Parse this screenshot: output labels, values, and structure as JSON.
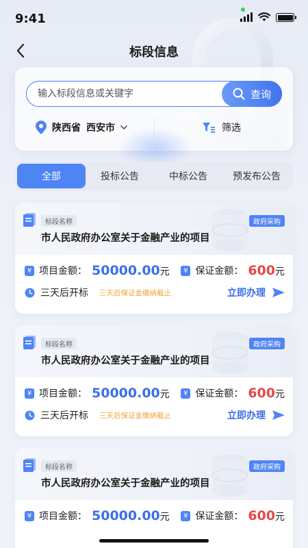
{
  "status_bar": {
    "time": "9:41"
  },
  "nav": {
    "title": "标段信息"
  },
  "search": {
    "placeholder": "输入标段信息或关键字",
    "button_label": "查询"
  },
  "location": {
    "province": "陕西省",
    "city": "西安市"
  },
  "filter": {
    "label": "筛选"
  },
  "tabs": [
    {
      "label": "全部",
      "active": true
    },
    {
      "label": "投标公告",
      "active": false
    },
    {
      "label": "中标公告",
      "active": false
    },
    {
      "label": "预发布公告",
      "active": false
    }
  ],
  "cards": [
    {
      "tag": "标段名称",
      "category": "政府采购",
      "title": "市人民政府办公室关于金融产业的项目",
      "amount_label": "项目金额：",
      "amount_value": "50000.00",
      "amount_unit": "元",
      "deposit_label": "保证金额：",
      "deposit_value": "600",
      "deposit_unit": "元",
      "open_text": "三天后开标",
      "deadline_note": "三天后保证金缴纳截止",
      "action": "立即办理"
    },
    {
      "tag": "标段名称",
      "category": "政府采购",
      "title": "市人民政府办公室关于金融产业的项目",
      "amount_label": "项目金额：",
      "amount_value": "50000.00",
      "amount_unit": "元",
      "deposit_label": "保证金额：",
      "deposit_value": "600",
      "deposit_unit": "元",
      "open_text": "三天后开标",
      "deadline_note": "三天后保证金缴纳截止",
      "action": "立即办理"
    },
    {
      "tag": "标段名称",
      "category": "政府采购",
      "title": "市人民政府办公室关于金融产业的项目",
      "amount_label": "项目金额：",
      "amount_value": "50000.00",
      "amount_unit": "元",
      "deposit_label": "保证金额：",
      "deposit_value": "600",
      "deposit_unit": "元"
    }
  ],
  "colors": {
    "accent": "#4f84f5",
    "amount": "#3c6fe8",
    "deposit": "#e54848",
    "note": "#f0a23a"
  },
  "icons": [
    "back-arrow-icon",
    "search-icon",
    "location-pin-icon",
    "chevron-down-icon",
    "filter-icon",
    "document-icon",
    "yen-icon",
    "clock-icon",
    "send-icon"
  ]
}
